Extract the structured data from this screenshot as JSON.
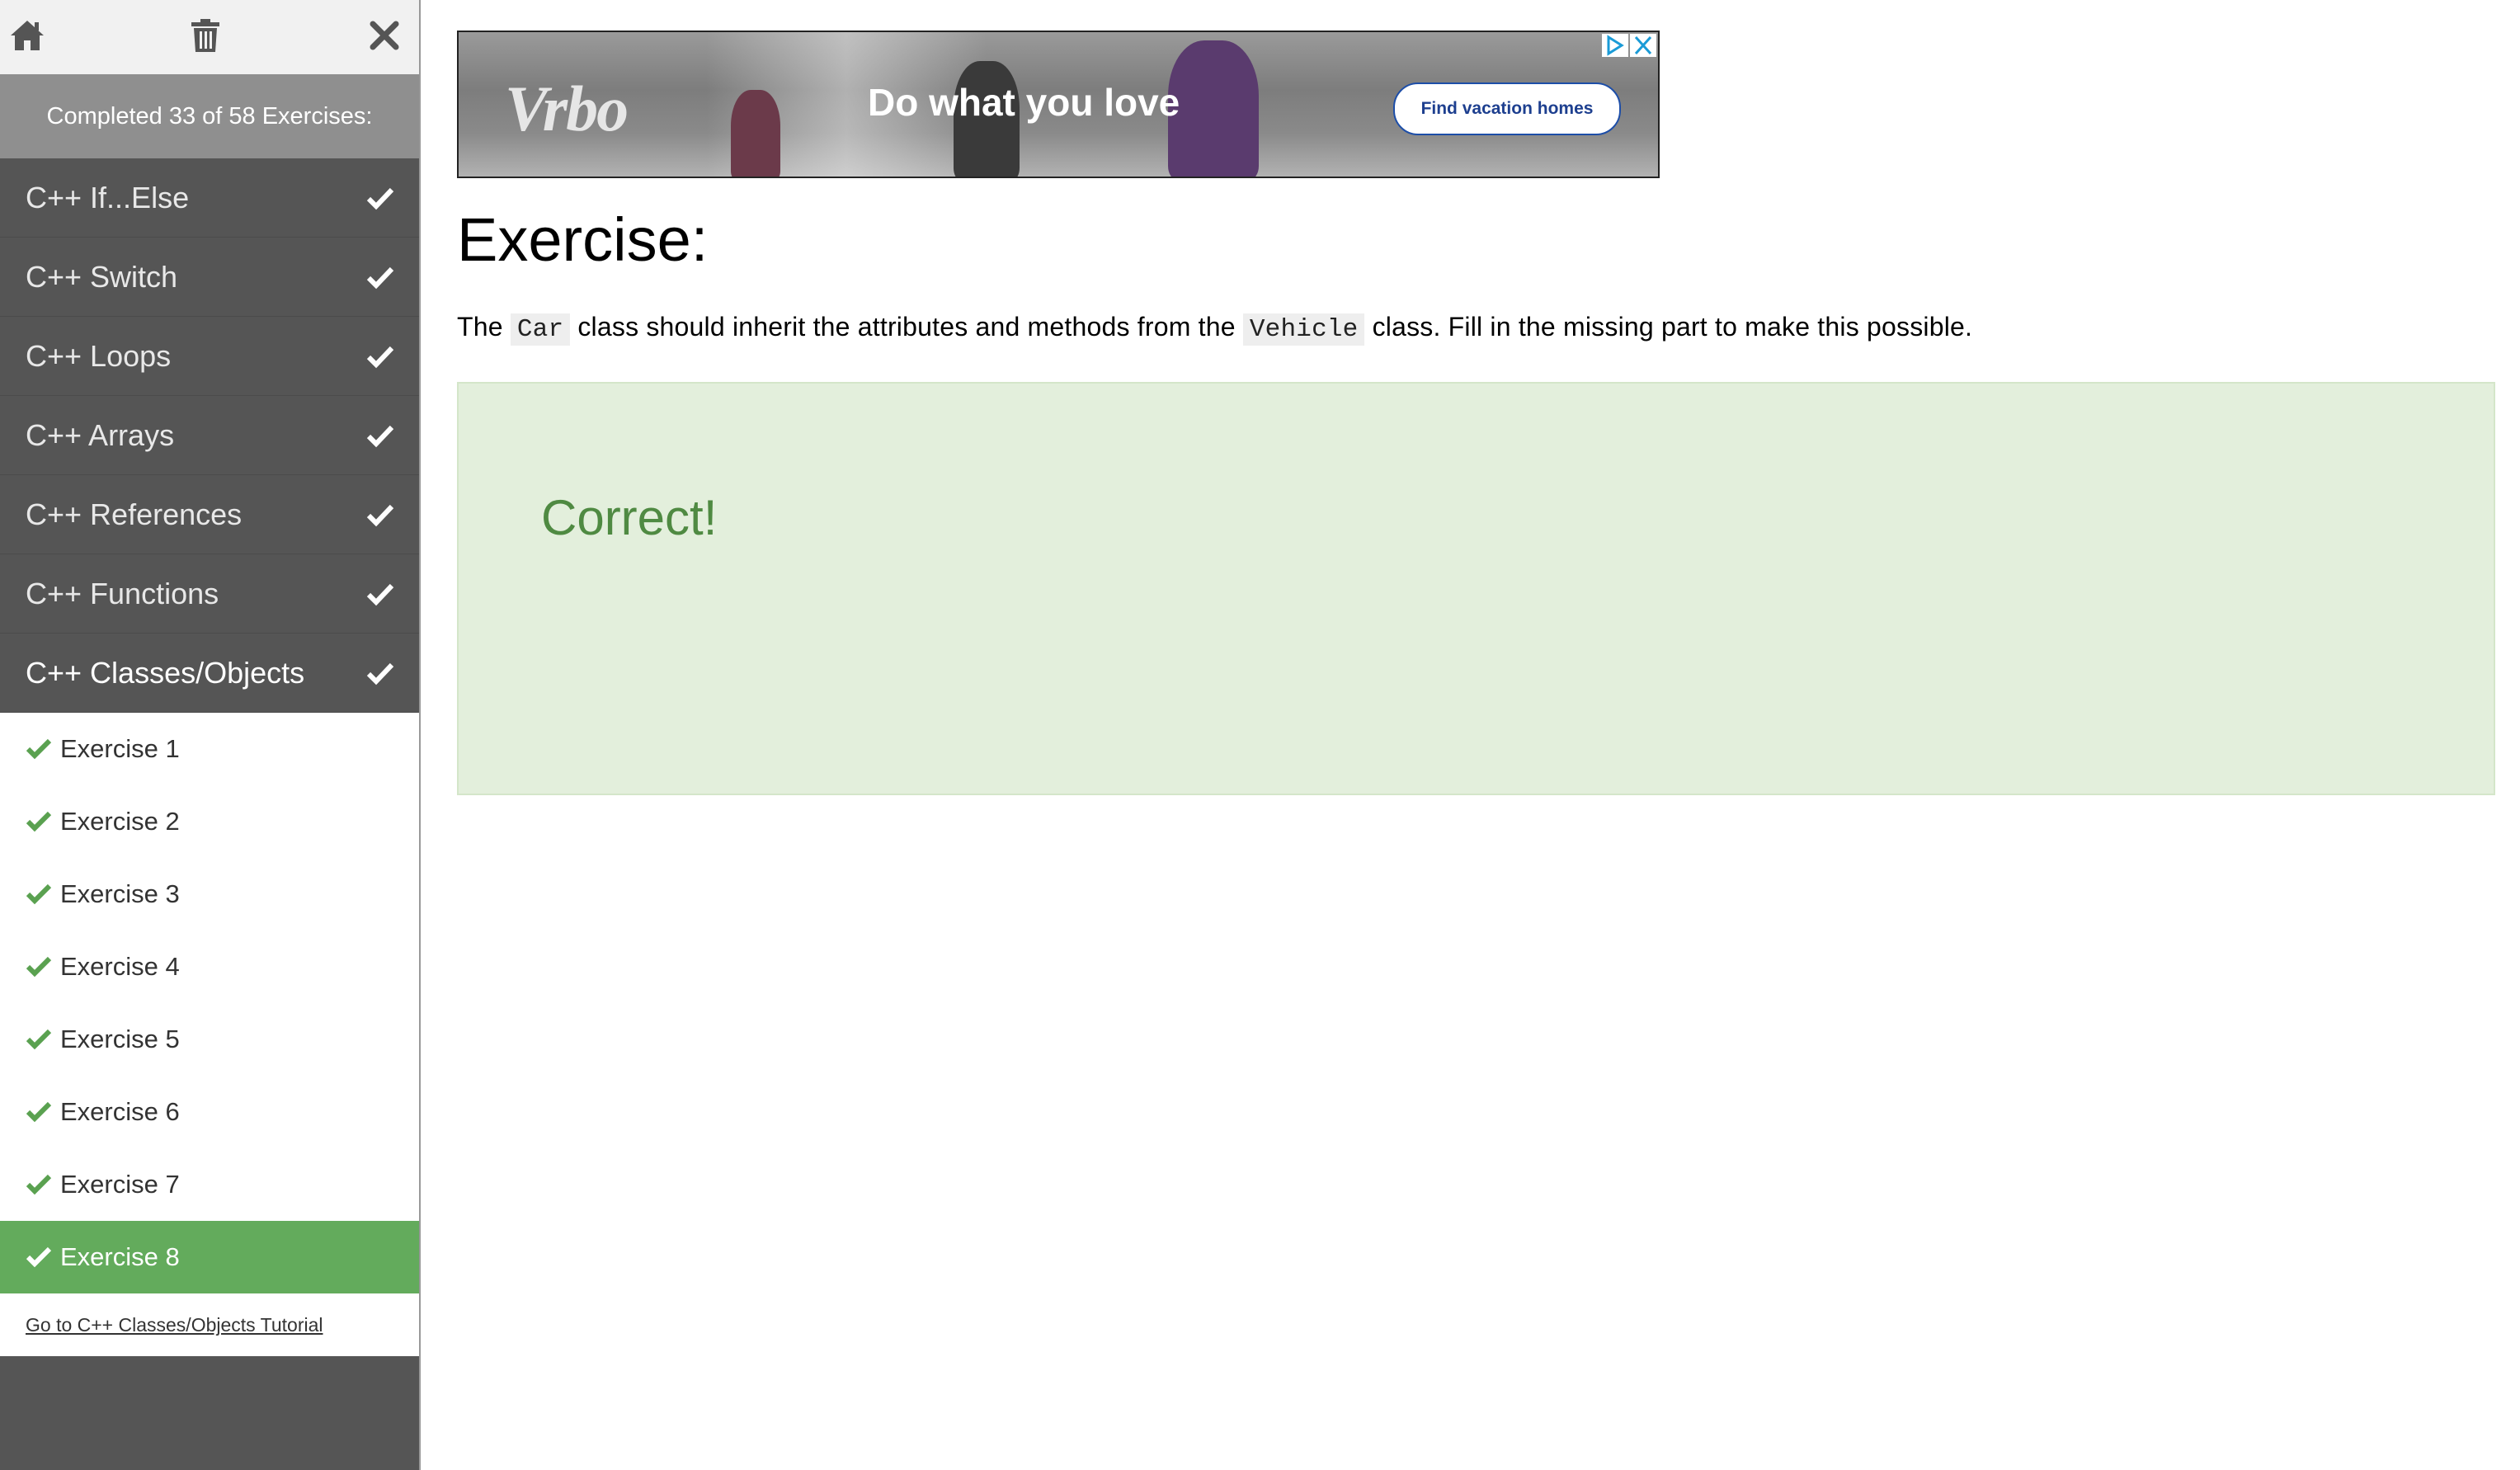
{
  "sidebar": {
    "topbar_icons": [
      "home-icon",
      "trash-icon",
      "close-icon"
    ],
    "progress_text": "Completed 33 of 58 Exercises:",
    "categories": [
      {
        "label": "C++ If...Else"
      },
      {
        "label": "C++ Switch"
      },
      {
        "label": "C++ Loops"
      },
      {
        "label": "C++ Arrays"
      },
      {
        "label": "C++ References"
      },
      {
        "label": "C++ Functions"
      },
      {
        "label": "C++ Classes/Objects"
      }
    ],
    "exercises": [
      {
        "label": "Exercise 1"
      },
      {
        "label": "Exercise 2"
      },
      {
        "label": "Exercise 3"
      },
      {
        "label": "Exercise 4"
      },
      {
        "label": "Exercise 5"
      },
      {
        "label": "Exercise 6"
      },
      {
        "label": "Exercise 7"
      },
      {
        "label": "Exercise 8"
      }
    ],
    "tutorial_link": "Go to C++ Classes/Objects Tutorial"
  },
  "ad": {
    "brand": "Vrbo",
    "headline": "Do what you love",
    "cta": "Find vacation homes"
  },
  "main": {
    "title": "Exercise:",
    "instruction": {
      "part1": "The",
      "code1": "Car",
      "part2": "class should inherit the attributes and methods from the",
      "code2": "Vehicle",
      "part3": "class. Fill in the missing part to make this possible."
    },
    "result_message": "Correct!"
  },
  "colors": {
    "sidebar_bg": "#555555",
    "progress_bg": "#8f8f8f",
    "current_exercise_bg": "#63ab5c",
    "check_green": "#5aa150",
    "result_bg": "#e3efdc",
    "result_text": "#4f8a42"
  }
}
